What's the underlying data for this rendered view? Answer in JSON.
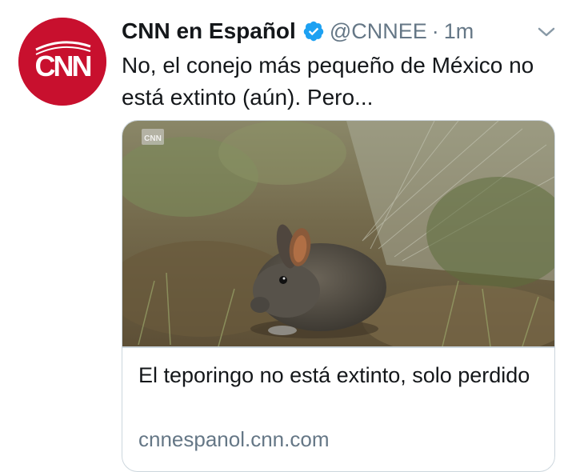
{
  "tweet": {
    "display_name": "CNN en Español",
    "handle": "@CNNEE",
    "separator": "·",
    "time": "1m",
    "text": "No, el conejo más pequeño de México no está extinto (aún). Pero...",
    "avatar_text": "CNN",
    "verified_icon": "verified-badge-icon",
    "more_icon": "chevron-down-icon"
  },
  "card": {
    "watermark": "CNN",
    "title": "El teporingo no está extinto, solo perdido",
    "domain": "cnnespanol.cnn.com"
  },
  "colors": {
    "brand_red": "#c8102e",
    "verified_blue": "#1da1f2",
    "secondary_text": "#657786",
    "border": "#ccd6dd"
  }
}
